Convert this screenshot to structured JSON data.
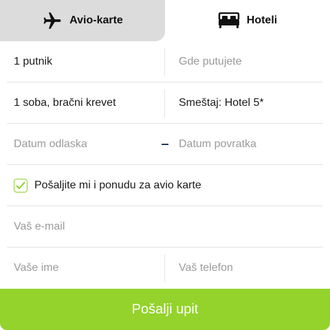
{
  "tabs": {
    "flights": {
      "label": "Avio-karte",
      "icon": "airplane-icon",
      "active": true
    },
    "hotels": {
      "label": "Hoteli",
      "icon": "bed-icon",
      "active": false
    }
  },
  "form": {
    "travelers": {
      "value": "1 putnik"
    },
    "destination": {
      "placeholder": "Gde putujete"
    },
    "room": {
      "value": "1 soba, bračni krevet"
    },
    "accommodation": {
      "value": "Smeštaj: Hotel 5*"
    },
    "departure_date": {
      "placeholder": "Datum odlaska"
    },
    "return_date": {
      "placeholder": "Datum povratka"
    },
    "flight_offer": {
      "label": "Pošaljite mi i ponudu za avio karte",
      "checked": true
    },
    "email": {
      "placeholder": "Vaš e-mail"
    },
    "name": {
      "placeholder": "Vaše ime"
    },
    "phone": {
      "placeholder": "Vaš telefon"
    },
    "submit_label": "Pošalji upit"
  },
  "colors": {
    "accent": "#93d32b",
    "tab_active_bg": "#dcdcdc",
    "divider": "#e3e3e3",
    "placeholder": "#9a9a9a",
    "date_dash": "#1f3c57"
  }
}
